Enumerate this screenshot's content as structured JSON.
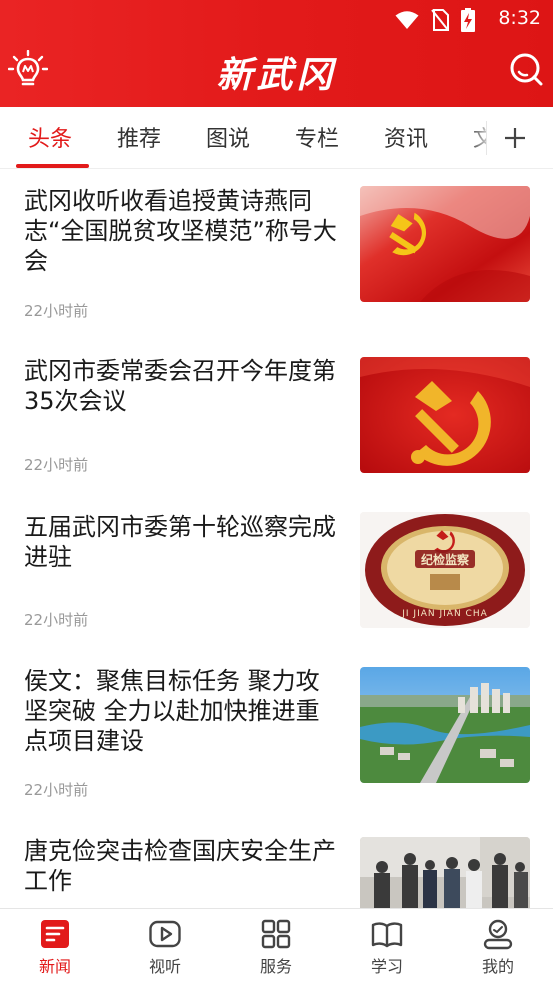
{
  "status_bar": {
    "time": "8:32",
    "icons": [
      "wifi-icon",
      "no-sim-icon",
      "battery-charging-icon"
    ]
  },
  "header": {
    "title": "新武冈",
    "left_icon": "lightbulb-icon",
    "right_icon": "search-icon"
  },
  "tabs": [
    {
      "label": "头条",
      "active": true
    },
    {
      "label": "推荐",
      "active": false
    },
    {
      "label": "图说",
      "active": false
    },
    {
      "label": "专栏",
      "active": false
    },
    {
      "label": "资讯",
      "active": false
    },
    {
      "label": "文",
      "active": false
    }
  ],
  "tabs_more_icon": "plus-icon",
  "news": [
    {
      "title": "武冈收听收看追授黄诗燕同志“全国脱贫攻坚模范”称号大会",
      "time": "22小时前",
      "thumb": "party-flag-image"
    },
    {
      "title": "武冈市委常委会召开今年度第35次会议",
      "time": "22小时前",
      "thumb": "hammer-sickle-image"
    },
    {
      "title": "五届武冈市委第十轮巡察完成进驻",
      "time": "22小时前",
      "thumb": "discipline-inspection-logo",
      "thumb_text": {
        "main": "纪检监察",
        "ring": "JI JIAN JIAN CHA"
      }
    },
    {
      "title": "侯文：聚焦目标任务 聚力攻坚突破 全力以赴加快推进重点项目建设",
      "time": "22小时前",
      "thumb": "city-aerial-photo"
    },
    {
      "title": "唐克俭突击检查国庆安全生产工作",
      "time": "",
      "thumb": "inspection-group-photo"
    }
  ],
  "bottom_nav": [
    {
      "label": "新闻",
      "icon": "news-icon",
      "active": true
    },
    {
      "label": "视听",
      "icon": "play-icon",
      "active": false
    },
    {
      "label": "服务",
      "icon": "grid-icon",
      "active": false
    },
    {
      "label": "学习",
      "icon": "book-icon",
      "active": false
    },
    {
      "label": "我的",
      "icon": "profile-icon",
      "active": false
    }
  ],
  "colors": {
    "brand_red": "#e21a1a",
    "text_dark": "#1a1a1a",
    "text_muted": "#999999",
    "nav_text": "#444444"
  }
}
